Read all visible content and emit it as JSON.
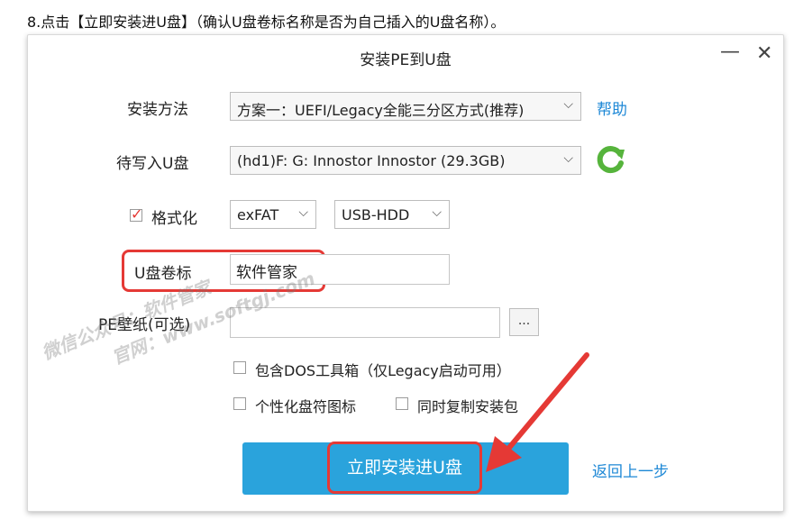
{
  "caption": "8.点击【立即安装进U盘】（确认U盘卷标名称是否为自己插入的U盘名称）。",
  "window": {
    "title": "安装PE到U盘",
    "minimize": "—",
    "close": "✕"
  },
  "install_method": {
    "label": "安装方法",
    "value": "方案一：UEFI/Legacy全能三分区方式(推荐)",
    "help": "帮助"
  },
  "target_disk": {
    "label": "待写入U盘",
    "value": "(hd1)F: G: Innostor Innostor (29.3GB)"
  },
  "format": {
    "label": "格式化",
    "checked": true,
    "fs_value": "exFAT",
    "mode_value": "USB-HDD"
  },
  "volume_label": {
    "label": "U盘卷标",
    "value": "软件管家"
  },
  "wallpaper": {
    "label": "PE壁纸(可选)",
    "value": "",
    "browse": "..."
  },
  "options": {
    "dos_tools": "包含DOS工具箱（仅Legacy启动可用）",
    "personalized_icon": "个性化盘符图标",
    "copy_installer": "同时复制安装包"
  },
  "actions": {
    "install": "立即安装进U盘",
    "back": "返回上一步"
  },
  "watermark": {
    "line1": "微信公众号：软件管家",
    "line2": "官网：www.softgj.com"
  },
  "colors": {
    "accent": "#2aa3dc",
    "highlight": "#e53935",
    "link": "#1e88d6"
  }
}
